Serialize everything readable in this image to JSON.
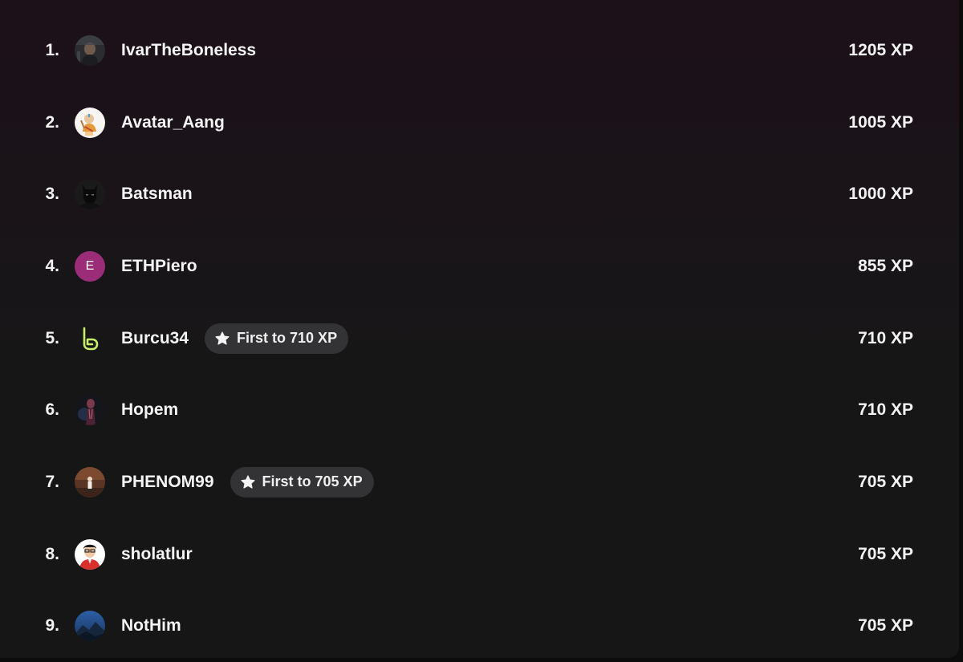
{
  "leaderboard": {
    "rows": [
      {
        "rank": "1.",
        "name": "IvarTheBoneless",
        "xp": "1205 XP",
        "avatar_icon": "viking-photo-avatar-icon"
      },
      {
        "rank": "2.",
        "name": "Avatar_Aang",
        "xp": "1005 XP",
        "avatar_icon": "aang-cartoon-avatar-icon"
      },
      {
        "rank": "3.",
        "name": "Batsman",
        "xp": "1000 XP",
        "avatar_icon": "batman-avatar-icon"
      },
      {
        "rank": "4.",
        "name": "ETHPiero",
        "xp": "855 XP",
        "avatar_icon": "letter-avatar-icon",
        "avatar_letter": "E",
        "avatar_color": "#9b2d78"
      },
      {
        "rank": "5.",
        "name": "Burcu34",
        "xp": "710 XP",
        "avatar_icon": "green-b-logo-avatar-icon",
        "badge": "First to 710 XP",
        "badge_icon": "star-icon"
      },
      {
        "rank": "6.",
        "name": "Hopem",
        "xp": "710 XP",
        "avatar_icon": "dark-figure-avatar-icon"
      },
      {
        "rank": "7.",
        "name": "PHENOM99",
        "xp": "705 XP",
        "avatar_icon": "stage-photo-avatar-icon",
        "badge": "First to 705 XP",
        "badge_icon": "star-icon"
      },
      {
        "rank": "8.",
        "name": "sholatlur",
        "xp": "705 XP",
        "avatar_icon": "cartoon-man-avatar-icon"
      },
      {
        "rank": "9.",
        "name": "NotHim",
        "xp": "705 XP",
        "avatar_icon": "blue-landscape-avatar-icon"
      }
    ]
  },
  "colors": {
    "text": "#f2f2f2",
    "badge_bg": "#333335",
    "background_top": "#1c1019",
    "background_bottom": "#161616",
    "burcu_logo": "#c6ef6a"
  }
}
